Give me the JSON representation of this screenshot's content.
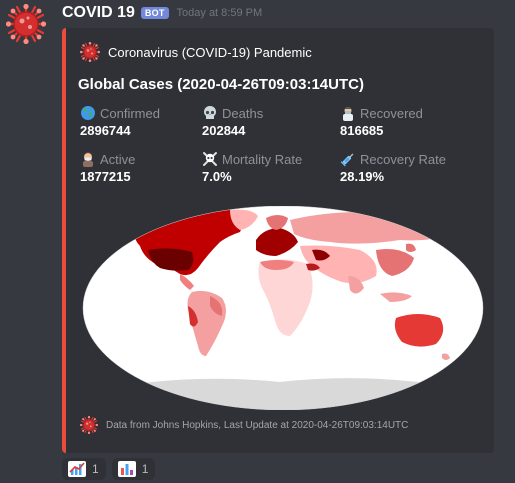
{
  "message": {
    "username": "COVID 19",
    "bot_tag": "BOT",
    "timestamp": "Today at 8:59 PM"
  },
  "embed": {
    "accent_color": "#e74c3c",
    "author": "Coronavirus (COVID-19) Pandemic",
    "title": "Global Cases (2020-04-26T09:03:14UTC)",
    "fields": [
      {
        "name": "Confirmed",
        "value": "2896744",
        "icon": "earth-icon"
      },
      {
        "name": "Deaths",
        "value": "202844",
        "icon": "skull-icon"
      },
      {
        "name": "Recovered",
        "value": "816685",
        "icon": "doctor-icon"
      },
      {
        "name": "Active",
        "value": "1877215",
        "icon": "sick-face-icon"
      },
      {
        "name": "Mortality Rate",
        "value": "7.0%",
        "icon": "skull-crossbones-icon"
      },
      {
        "name": "Recovery Rate",
        "value": "28.19%",
        "icon": "syringe-icon"
      }
    ],
    "footer": "Data from Johns Hopkins, Last Update at 2020-04-26T09:03:14UTC"
  },
  "reactions": [
    {
      "icon": "chart-increasing-icon",
      "count": "1"
    },
    {
      "icon": "bar-chart-icon",
      "count": "1"
    }
  ]
}
